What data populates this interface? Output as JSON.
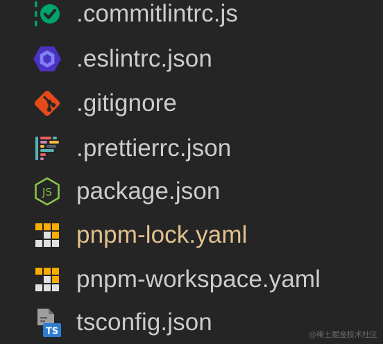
{
  "files": [
    {
      "name": ".commitlintrc.js",
      "icon": "commitlint-icon",
      "modified": false
    },
    {
      "name": ".eslintrc.json",
      "icon": "eslint-icon",
      "modified": false
    },
    {
      "name": ".gitignore",
      "icon": "git-icon",
      "modified": false
    },
    {
      "name": ".prettierrc.json",
      "icon": "prettier-icon",
      "modified": false
    },
    {
      "name": "package.json",
      "icon": "nodejs-icon",
      "modified": false
    },
    {
      "name": "pnpm-lock.yaml",
      "icon": "pnpm-icon",
      "modified": true
    },
    {
      "name": "pnpm-workspace.yaml",
      "icon": "pnpm-icon",
      "modified": false
    },
    {
      "name": "tsconfig.json",
      "icon": "typescript-config-icon",
      "modified": false
    }
  ],
  "colors": {
    "background": "#252526",
    "text": "#cccccc",
    "modified_text": "#e2c08d",
    "commitlint": "#00a36c",
    "eslint": "#4b32c3",
    "git": "#e64a19",
    "nodejs": "#8bc34a",
    "pnpm": "#f9ad00",
    "typescript": "#2d7dd2"
  },
  "watermark": "@稀土掘金技术社区"
}
